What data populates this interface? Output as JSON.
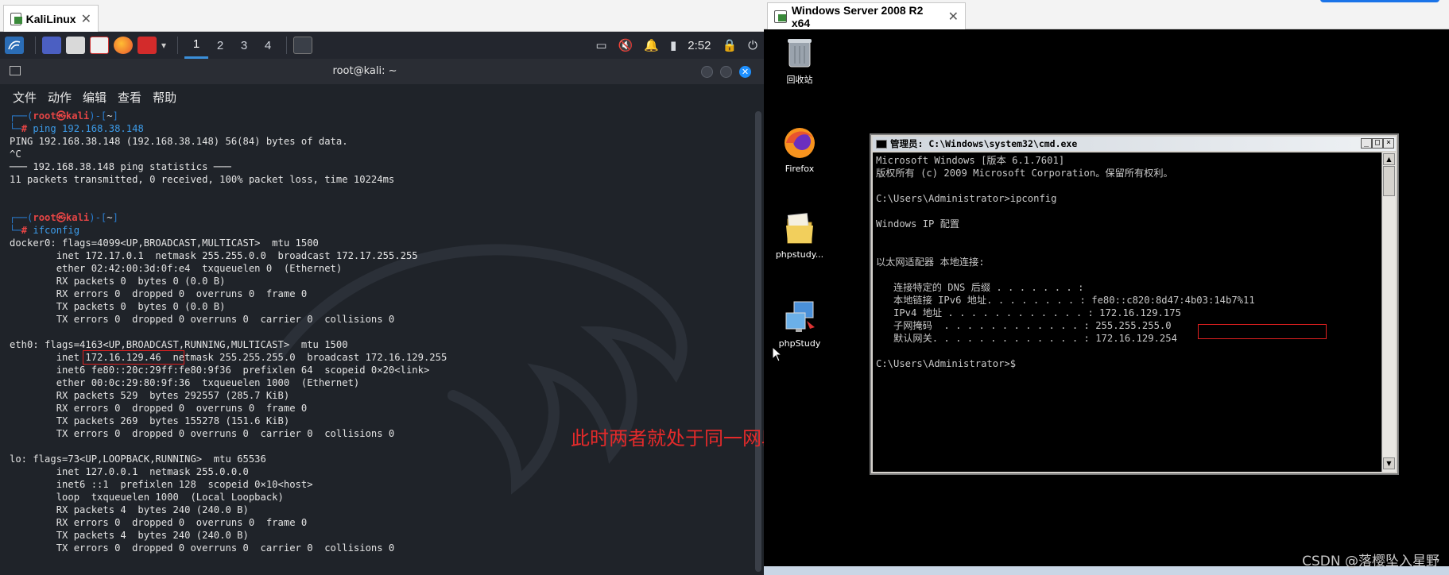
{
  "kali_vm": {
    "tab_title": "KaliLinux",
    "tab_close": "✕",
    "panel": {
      "workspaces": [
        "1",
        "2",
        "3",
        "4"
      ],
      "active_workspace": "1",
      "clock": "2:52"
    },
    "terminal": {
      "title": "root@kali: ~",
      "close_label": "✕",
      "menu": [
        "文件",
        "动作",
        "编辑",
        "查看",
        "帮助"
      ],
      "lines": [
        [
          [
            "┌──(",
            "b"
          ],
          [
            "root㉿kali",
            "r"
          ],
          [
            ")-[",
            "b"
          ],
          [
            "~",
            "w"
          ],
          [
            "]",
            "b"
          ]
        ],
        [
          [
            "└─",
            "b"
          ],
          [
            "#",
            "r"
          ],
          [
            " ping 192.168.38.148",
            "c"
          ]
        ],
        [
          [
            "PING 192.168.38.148 (192.168.38.148) 56(84) bytes of data.",
            "w"
          ]
        ],
        [
          [
            "^C",
            "w"
          ]
        ],
        [
          [
            "─── 192.168.38.148 ping statistics ───",
            "w"
          ]
        ],
        [
          [
            "11 packets transmitted, 0 received, 100% packet loss, time 10224ms",
            "w"
          ]
        ],
        [
          [
            "",
            "w"
          ]
        ],
        [
          [
            "",
            "w"
          ]
        ],
        [
          [
            "┌──(",
            "b"
          ],
          [
            "root㉿kali",
            "r"
          ],
          [
            ")-[",
            "b"
          ],
          [
            "~",
            "w"
          ],
          [
            "]",
            "b"
          ]
        ],
        [
          [
            "└─",
            "b"
          ],
          [
            "#",
            "r"
          ],
          [
            " ifconfig",
            "c"
          ]
        ],
        [
          [
            "docker0: flags=4099<UP,BROADCAST,MULTICAST>  mtu 1500",
            "w"
          ]
        ],
        [
          [
            "        inet 172.17.0.1  netmask 255.255.0.0  broadcast 172.17.255.255",
            "w"
          ]
        ],
        [
          [
            "        ether 02:42:00:3d:0f:e4  txqueuelen 0  (Ethernet)",
            "w"
          ]
        ],
        [
          [
            "        RX packets 0  bytes 0 (0.0 B)",
            "w"
          ]
        ],
        [
          [
            "        RX errors 0  dropped 0  overruns 0  frame 0",
            "w"
          ]
        ],
        [
          [
            "        TX packets 0  bytes 0 (0.0 B)",
            "w"
          ]
        ],
        [
          [
            "        TX errors 0  dropped 0 overruns 0  carrier 0  collisions 0",
            "w"
          ]
        ],
        [
          [
            "",
            "w"
          ]
        ],
        [
          [
            "eth0: flags=4163<UP,BROADCAST,RUNNING,MULTICAST>  mtu 1500",
            "w"
          ]
        ],
        [
          [
            "        inet 172.16.129.46  netmask 255.255.255.0  broadcast 172.16.129.255",
            "w"
          ]
        ],
        [
          [
            "        inet6 fe80::20c:29ff:fe80:9f36  prefixlen 64  scopeid 0×20<link>",
            "w"
          ]
        ],
        [
          [
            "        ether 00:0c:29:80:9f:36  txqueuelen 1000  (Ethernet)",
            "w"
          ]
        ],
        [
          [
            "        RX packets 529  bytes 292557 (285.7 KiB)",
            "w"
          ]
        ],
        [
          [
            "        RX errors 0  dropped 0  overruns 0  frame 0",
            "w"
          ]
        ],
        [
          [
            "        TX packets 269  bytes 155278 (151.6 KiB)",
            "w"
          ]
        ],
        [
          [
            "        TX errors 0  dropped 0 overruns 0  carrier 0  collisions 0",
            "w"
          ]
        ],
        [
          [
            "",
            "w"
          ]
        ],
        [
          [
            "lo: flags=73<UP,LOOPBACK,RUNNING>  mtu 65536",
            "w"
          ]
        ],
        [
          [
            "        inet 127.0.0.1  netmask 255.0.0.0",
            "w"
          ]
        ],
        [
          [
            "        inet6 ::1  prefixlen 128  scopeid 0×10<host>",
            "w"
          ]
        ],
        [
          [
            "        loop  txqueuelen 1000  (Local Loopback)",
            "w"
          ]
        ],
        [
          [
            "        RX packets 4  bytes 240 (240.0 B)",
            "w"
          ]
        ],
        [
          [
            "        RX errors 0  dropped 0  overruns 0  frame 0",
            "w"
          ]
        ],
        [
          [
            "        TX packets 4  bytes 240 (240.0 B)",
            "w"
          ]
        ],
        [
          [
            "        TX errors 0  dropped 0 overruns 0  carrier 0  collisions 0",
            "w"
          ]
        ]
      ]
    }
  },
  "windows_vm": {
    "tab_title": "Windows Server 2008 R2 x64",
    "tab_close": "✕",
    "desktop_icons": [
      {
        "label": "回收站",
        "icon": "recycle-bin-icon"
      },
      {
        "label": "Firefox",
        "icon": "firefox-icon"
      },
      {
        "label": "phpstudy...",
        "icon": "folder-icon"
      },
      {
        "label": "phpStudy",
        "icon": "phpstudy-icon"
      }
    ],
    "cmd": {
      "title": "管理员: C:\\Windows\\system32\\cmd.exe",
      "lines": [
        "Microsoft Windows [版本 6.1.7601]",
        "版权所有 (c) 2009 Microsoft Corporation。保留所有权利。",
        "",
        "C:\\Users\\Administrator>ipconfig",
        "",
        "Windows IP 配置",
        "",
        "",
        "以太网适配器 本地连接:",
        "",
        "   连接特定的 DNS 后缀 . . . . . . . :",
        "   本地链接 IPv6 地址. . . . . . . . : fe80::c820:8d47:4b03:14b7%11",
        "   IPv4 地址 . . . . . . . . . . . . : 172.16.129.175",
        "   子网掩码  . . . . . . . . . . . . : 255.255.255.0",
        "   默认网关. . . . . . . . . . . . . : 172.16.129.254",
        "",
        "C:\\Users\\Administrator>$"
      ]
    }
  },
  "annotation": "此时两者就处于同一网段之下了",
  "watermark": "CSDN @落樱坠入星野",
  "colors": {
    "kali_bg": "#1f2329",
    "prompt_blue": "#2a7fd4",
    "prompt_red": "#e64545",
    "highlight_red": "#e02020",
    "annotation_red": "#e42a2a"
  }
}
